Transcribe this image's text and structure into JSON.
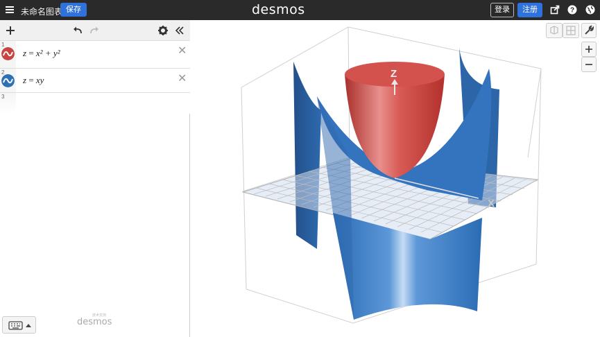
{
  "header": {
    "graph_title": "未命名图表",
    "save_label": "保存",
    "logo": "desmos",
    "login_label": "登录",
    "signup_label": "注册"
  },
  "expressions": [
    {
      "number": "1",
      "color": "#c74440",
      "latex_z": "z",
      "latex_eq": "=",
      "latex_rhs": "x² + y²"
    },
    {
      "number": "2",
      "color": "#2d70b3",
      "latex_z": "z",
      "latex_eq": "=",
      "latex_rhs": "xy"
    },
    {
      "number": "3"
    }
  ],
  "footer": {
    "powered_by": "desmos",
    "powered_small": "技术支持"
  },
  "graph": {
    "axis_x_label": "X",
    "axis_z_label": "Z"
  },
  "colors": {
    "header_bg": "#2a2a2a",
    "accent": "#2f72dc",
    "red_surface": "#c74440",
    "blue_surface": "#2d70b3"
  },
  "icons": {
    "menu": "hamburger-icon",
    "add": "plus-icon",
    "undo": "undo-icon",
    "redo": "redo-icon",
    "settings": "gear-icon",
    "collapse": "double-chevron-left-icon",
    "share": "share-icon",
    "help": "help-icon",
    "language": "globe-icon",
    "wrench": "wrench-icon",
    "zoom_in": "plus-icon",
    "zoom_out": "minus-icon",
    "keyboard": "keyboard-icon"
  }
}
